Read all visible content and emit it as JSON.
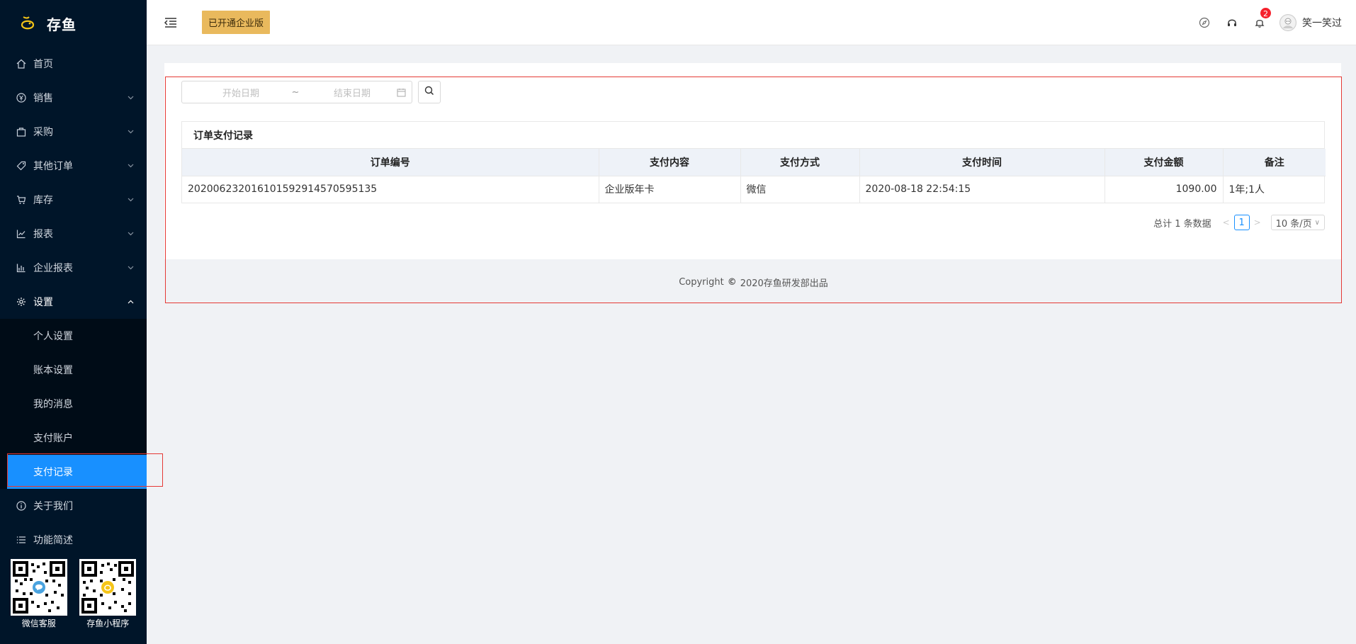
{
  "brand": {
    "name": "存鱼",
    "accent": "#e9b95d"
  },
  "sidebar": {
    "items": [
      {
        "label": "首页",
        "icon": "home-icon"
      },
      {
        "label": "销售",
        "icon": "yen-icon",
        "expandable": true
      },
      {
        "label": "采购",
        "icon": "bag-icon",
        "expandable": true
      },
      {
        "label": "其他订单",
        "icon": "tag-icon",
        "expandable": true
      },
      {
        "label": "库存",
        "icon": "cart-icon",
        "expandable": true
      },
      {
        "label": "报表",
        "icon": "line-chart-icon",
        "expandable": true
      },
      {
        "label": "企业报表",
        "icon": "bar-chart-icon",
        "expandable": true
      },
      {
        "label": "设置",
        "icon": "gear-icon",
        "expandable": true,
        "open": true
      }
    ],
    "settings_sub": [
      {
        "label": "个人设置"
      },
      {
        "label": "账本设置"
      },
      {
        "label": "我的消息"
      },
      {
        "label": "支付账户"
      },
      {
        "label": "支付记录",
        "active": true
      }
    ],
    "bottom_items": [
      {
        "label": "关于我们",
        "icon": "info-icon"
      },
      {
        "label": "功能简述",
        "icon": "list-icon"
      }
    ],
    "qr": [
      {
        "label": "微信客服"
      },
      {
        "label": "存鱼小程序"
      }
    ]
  },
  "header": {
    "enterprise_badge": "已开通企业版",
    "notification_count": "2",
    "username": "笑一笑过"
  },
  "filter": {
    "start_placeholder": "开始日期",
    "separator": "~",
    "end_placeholder": "结束日期"
  },
  "table": {
    "title": "订单支付记录",
    "columns": [
      "订单编号",
      "支付内容",
      "支付方式",
      "支付时间",
      "支付金额",
      "备注"
    ],
    "rows": [
      [
        "20200623201610159291457059513​5",
        "企业版年卡",
        "微信",
        "2020-08-18 22:54:15",
        "1090.00",
        "1年;1人"
      ]
    ]
  },
  "pager": {
    "total_text": "总计 1 条数据",
    "current_page": "1",
    "page_size": "10 条/页"
  },
  "footer": {
    "prefix": "Copyright",
    "mark": "©",
    "text": "2020存鱼研发部出品"
  }
}
